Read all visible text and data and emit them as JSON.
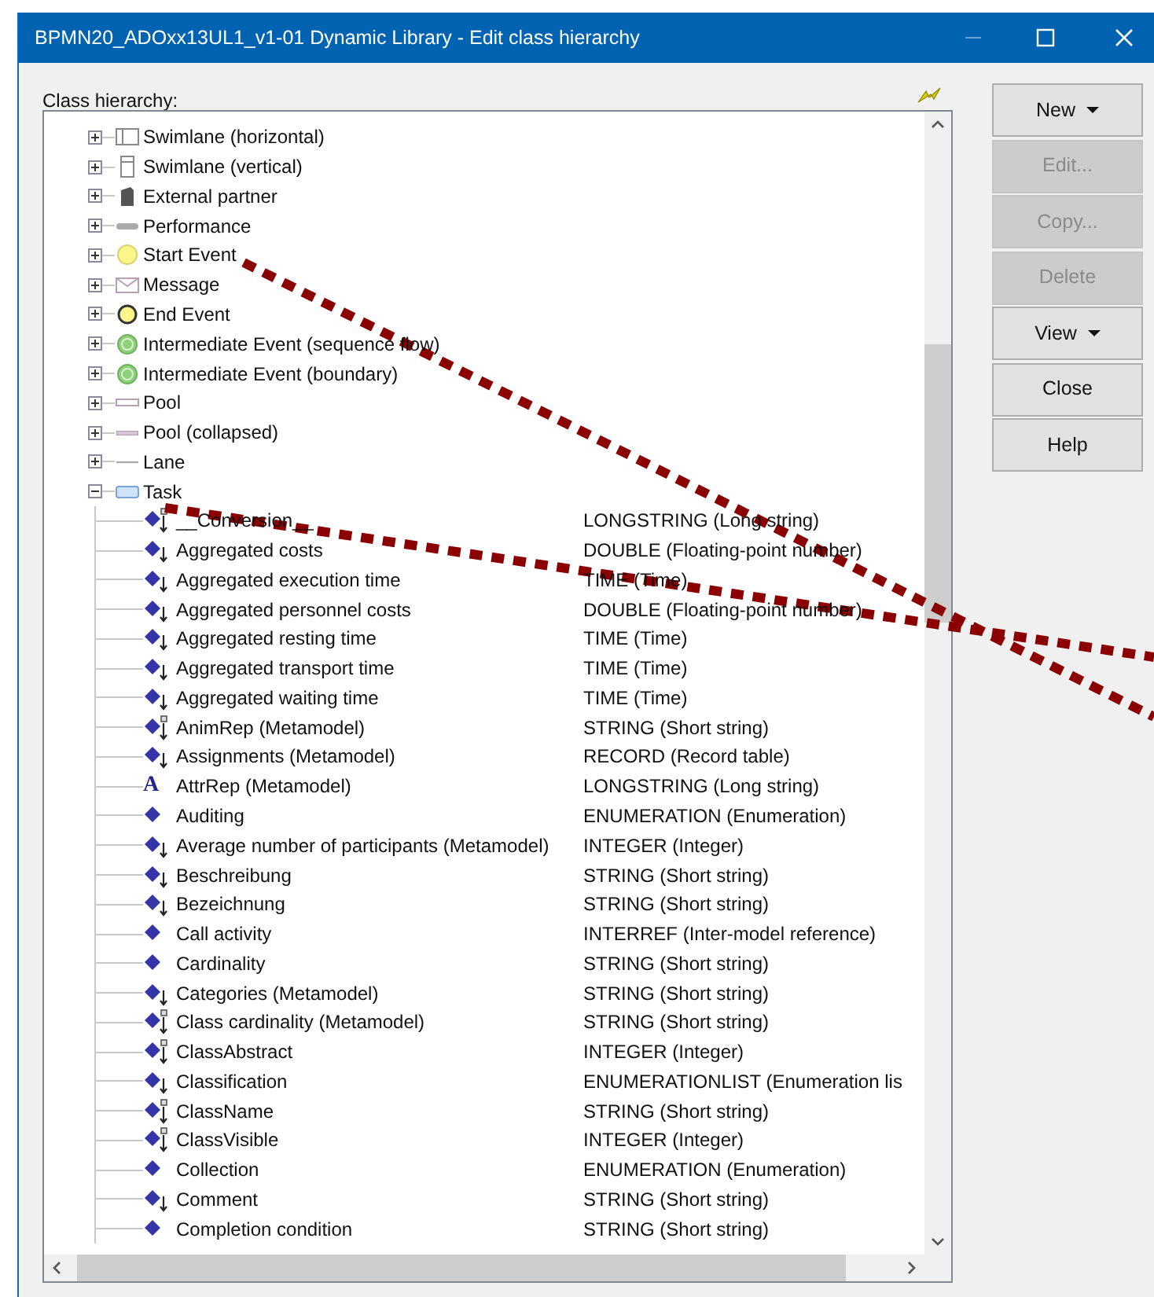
{
  "window": {
    "title": "BPMN20_ADOxx13UL1_v1-01 Dynamic Library - Edit class hierarchy"
  },
  "tree_label": "Class hierarchy:",
  "classes": [
    {
      "label": "Swimlane (horizontal)",
      "kind": "swimlane-h",
      "expanded": false
    },
    {
      "label": "Swimlane (vertical)",
      "kind": "swimlane-v",
      "expanded": false
    },
    {
      "label": "External partner",
      "kind": "partner",
      "expanded": false
    },
    {
      "label": "Performance",
      "kind": "performance",
      "expanded": false
    },
    {
      "label": "Start Event",
      "kind": "start-event",
      "expanded": false
    },
    {
      "label": "Message",
      "kind": "message",
      "expanded": false
    },
    {
      "label": "End Event",
      "kind": "end-event",
      "expanded": false
    },
    {
      "label": "Intermediate Event (sequence flow)",
      "kind": "intermediate",
      "expanded": false
    },
    {
      "label": "Intermediate Event (boundary)",
      "kind": "intermediate",
      "expanded": false
    },
    {
      "label": "Pool",
      "kind": "pool",
      "expanded": false
    },
    {
      "label": "Pool (collapsed)",
      "kind": "pool-collapsed",
      "expanded": false
    },
    {
      "label": "Lane",
      "kind": "lane",
      "expanded": false
    },
    {
      "label": "Task",
      "kind": "task",
      "expanded": true,
      "children": [
        {
          "name": "__Conversion__",
          "type": "LONGSTRING (Long string)",
          "kind": "diamond-box"
        },
        {
          "name": "Aggregated costs",
          "type": "DOUBLE (Floating-point number)",
          "kind": "diamond-arrow"
        },
        {
          "name": "Aggregated execution time",
          "type": "TIME (Time)",
          "kind": "diamond-arrow"
        },
        {
          "name": "Aggregated personnel costs",
          "type": "DOUBLE (Floating-point number)",
          "kind": "diamond-arrow"
        },
        {
          "name": "Aggregated resting time",
          "type": "TIME (Time)",
          "kind": "diamond-arrow"
        },
        {
          "name": "Aggregated transport time",
          "type": "TIME (Time)",
          "kind": "diamond-arrow"
        },
        {
          "name": "Aggregated waiting time",
          "type": "TIME (Time)",
          "kind": "diamond-arrow"
        },
        {
          "name": "AnimRep (Metamodel)",
          "type": "STRING (Short string)",
          "kind": "diamond-box"
        },
        {
          "name": "Assignments (Metamodel)",
          "type": "RECORD (Record table)",
          "kind": "diamond-arrow"
        },
        {
          "name": "AttrRep (Metamodel)",
          "type": "LONGSTRING (Long string)",
          "kind": "letter",
          "glyph": "A"
        },
        {
          "name": "Auditing",
          "type": "ENUMERATION (Enumeration)",
          "kind": "diamond"
        },
        {
          "name": "Average number of participants (Metamodel)",
          "type": "INTEGER (Integer)",
          "kind": "diamond-arrow"
        },
        {
          "name": "Beschreibung",
          "type": "STRING (Short string)",
          "kind": "diamond-arrow"
        },
        {
          "name": "Bezeichnung",
          "type": "STRING (Short string)",
          "kind": "diamond-arrow"
        },
        {
          "name": "Call activity",
          "type": "INTERREF (Inter-model reference)",
          "kind": "diamond"
        },
        {
          "name": "Cardinality",
          "type": "STRING (Short string)",
          "kind": "diamond"
        },
        {
          "name": "Categories (Metamodel)",
          "type": "STRING (Short string)",
          "kind": "diamond-arrow"
        },
        {
          "name": "Class cardinality (Metamodel)",
          "type": "STRING (Short string)",
          "kind": "diamond-box"
        },
        {
          "name": "ClassAbstract",
          "type": "INTEGER (Integer)",
          "kind": "diamond-box"
        },
        {
          "name": "Classification",
          "type": "ENUMERATIONLIST (Enumeration lis",
          "kind": "diamond-arrow"
        },
        {
          "name": "ClassName",
          "type": "STRING (Short string)",
          "kind": "diamond-box"
        },
        {
          "name": "ClassVisible",
          "type": "INTEGER (Integer)",
          "kind": "diamond-box"
        },
        {
          "name": "Collection",
          "type": "ENUMERATION (Enumeration)",
          "kind": "diamond"
        },
        {
          "name": "Comment",
          "type": "STRING (Short string)",
          "kind": "diamond-arrow"
        },
        {
          "name": "Completion condition",
          "type": "STRING (Short string)",
          "kind": "diamond"
        }
      ]
    }
  ],
  "buttons": [
    {
      "label": "New",
      "disabled": false,
      "has_menu": true
    },
    {
      "label": "Edit...",
      "disabled": true,
      "has_menu": false
    },
    {
      "label": "Copy...",
      "disabled": true,
      "has_menu": false
    },
    {
      "label": "Delete",
      "disabled": true,
      "has_menu": false
    },
    {
      "label": "View",
      "disabled": false,
      "has_menu": true
    },
    {
      "label": "Close",
      "disabled": false,
      "has_menu": false
    },
    {
      "label": "Help",
      "disabled": false,
      "has_menu": false
    }
  ]
}
